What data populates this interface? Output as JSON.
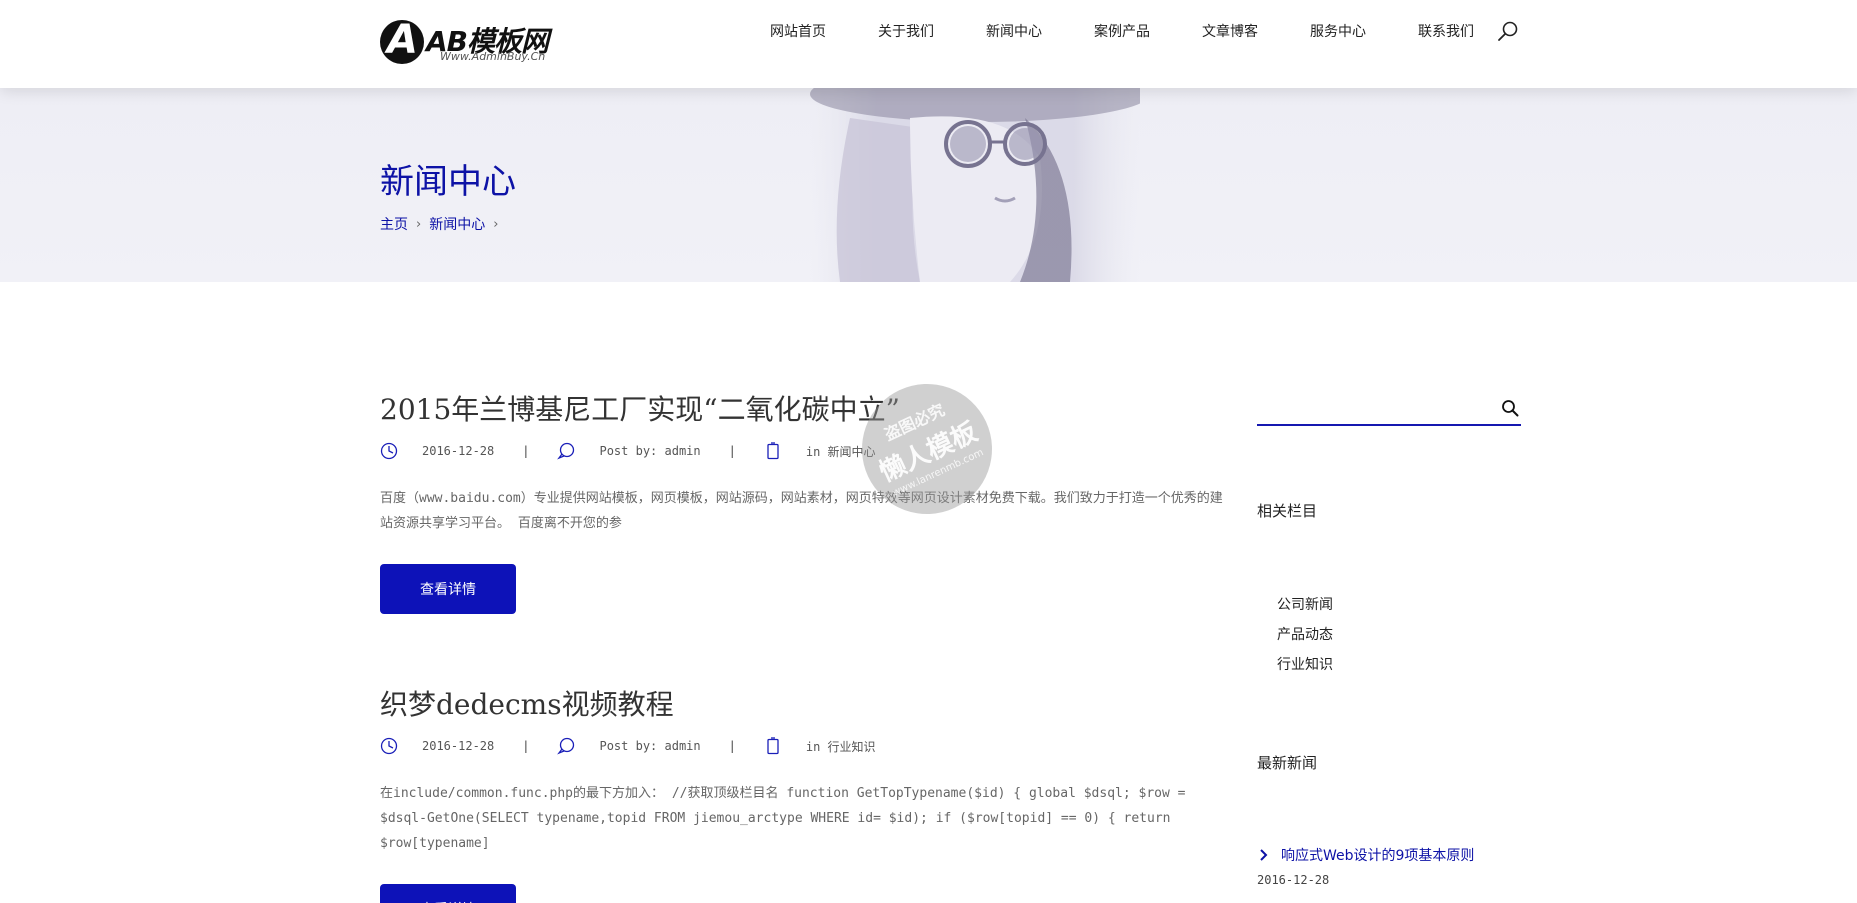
{
  "header": {
    "logo_text": "AB模板网",
    "logo_sub": "Www.AdminBuy.Cn",
    "nav": [
      {
        "label": "网站首页"
      },
      {
        "label": "关于我们"
      },
      {
        "label": "新闻中心"
      },
      {
        "label": "案例产品"
      },
      {
        "label": "文章博客"
      },
      {
        "label": "服务中心"
      },
      {
        "label": "联系我们"
      }
    ],
    "search_icon": "search-icon"
  },
  "banner": {
    "title": "新闻中心",
    "breadcrumb": [
      {
        "label": "主页"
      },
      {
        "label": "新闻中心"
      }
    ]
  },
  "posts": [
    {
      "title": "2015年兰博基尼工厂实现“二氧化碳中立”",
      "date": "2016-12-28",
      "author": "Post by: admin",
      "category": "in 新闻中心",
      "excerpt": "百度（www.baidu.com）专业提供网站模板，网页模板，网站源码，网站素材，网页特效等网页设计素材免费下载。我们致力于打造一个优秀的建站资源共享学习平台。 百度离不开您的参",
      "button": "查看详情"
    },
    {
      "title": "织梦dedecms视频教程",
      "date": "2016-12-28",
      "author": "Post by: admin",
      "category": "in 行业知识",
      "excerpt": "在include/common.func.php的最下方加入： //获取顶级栏目名 function GetTopTypename($id) { global $dsql; $row = $dsql-GetOne(SELECT typename,topid FROM jiemou_arctype WHERE id= $id); if ($row[topid] == 0) { return $row[typename]",
      "button": "查看详情"
    }
  ],
  "watermark": {
    "line1": "盗图必究",
    "line2": "懒人模板",
    "line3": "www.lanrenmb.com"
  },
  "sidebar": {
    "search_placeholder": "",
    "related_heading": "相关栏目",
    "categories": [
      {
        "label": "公司新闻"
      },
      {
        "label": "产品动态"
      },
      {
        "label": "行业知识"
      }
    ],
    "latest_heading": "最新新闻",
    "latest": [
      {
        "title": "响应式Web设计的9项基本原则",
        "date": "2016-12-28"
      }
    ]
  },
  "colors": {
    "accent": "#0d12b8",
    "link": "#0d12a6",
    "banner_bg": "#eeeef5"
  }
}
